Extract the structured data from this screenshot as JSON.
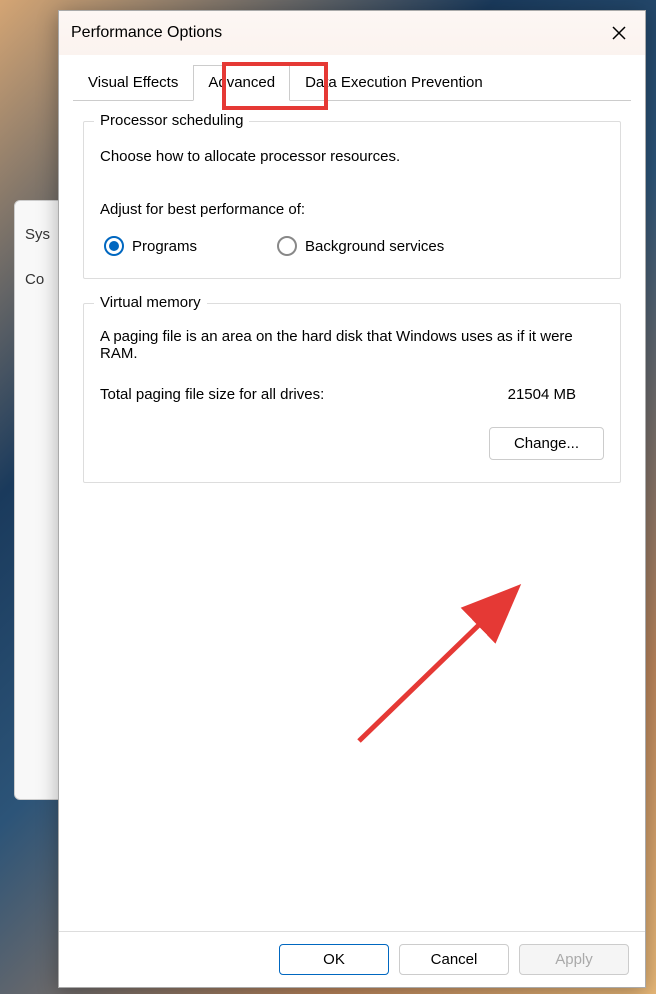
{
  "bg": {
    "text1": "Sys",
    "text2": "Co"
  },
  "title": "Performance Options",
  "tabs": {
    "visual": "Visual Effects",
    "advanced": "Advanced",
    "dep": "Data Execution Prevention"
  },
  "processor": {
    "title": "Processor scheduling",
    "desc": "Choose how to allocate processor resources.",
    "label": "Adjust for best performance of:",
    "opt_programs": "Programs",
    "opt_background": "Background services"
  },
  "vm": {
    "title": "Virtual memory",
    "desc": "A paging file is an area on the hard disk that Windows uses as if it were RAM.",
    "total_label": "Total paging file size for all drives:",
    "total_value": "21504 MB",
    "change": "Change..."
  },
  "buttons": {
    "ok": "OK",
    "cancel": "Cancel",
    "apply": "Apply"
  }
}
